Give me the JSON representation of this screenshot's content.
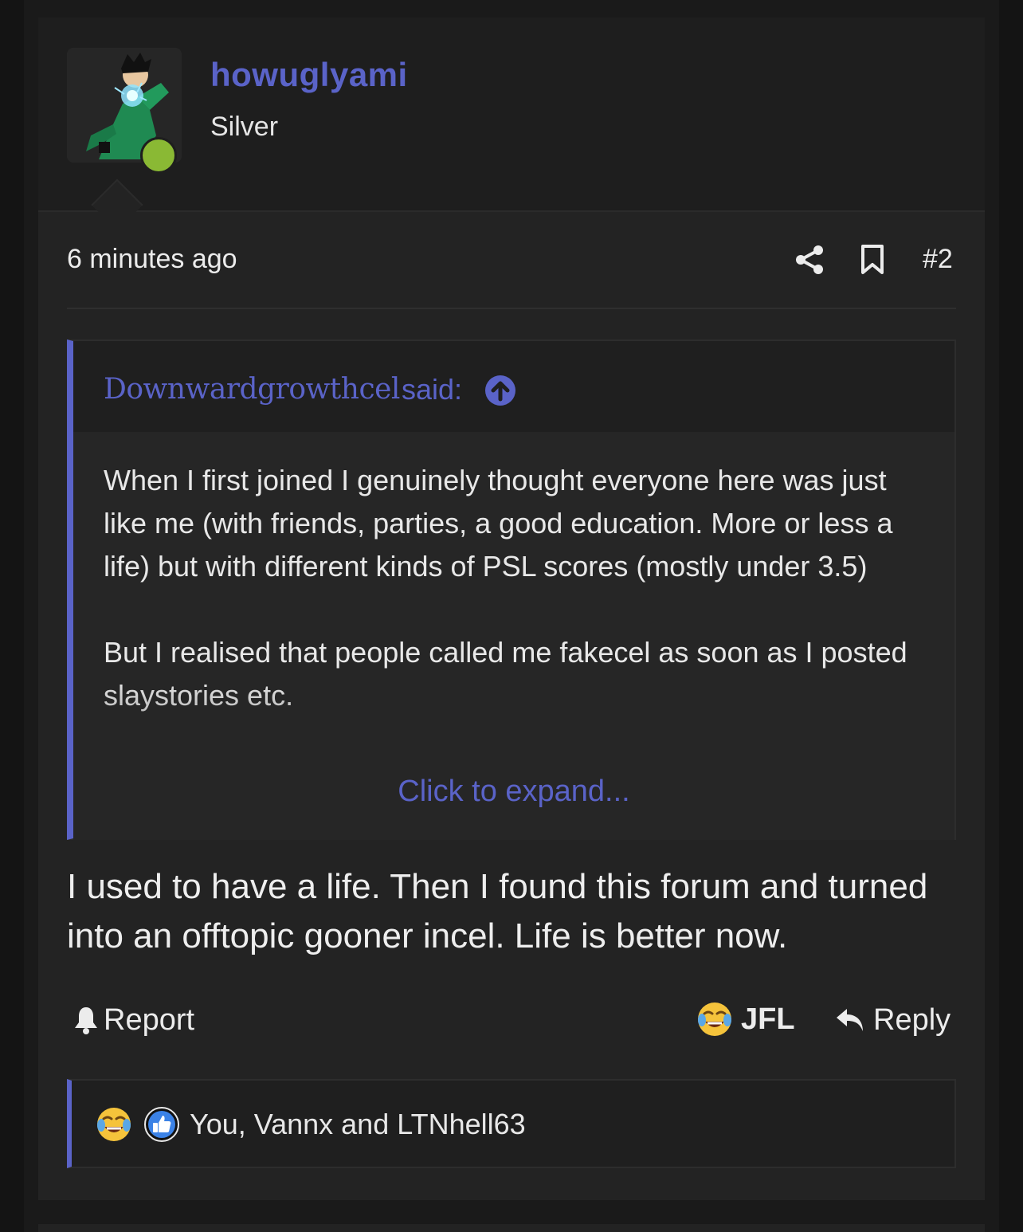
{
  "post": {
    "user": {
      "name": "howuglyami",
      "title": "Silver",
      "online": true
    },
    "meta": {
      "time": "6 minutes ago",
      "number": "#2",
      "share_icon": "share-icon",
      "bookmark_icon": "bookmark-icon"
    },
    "quote": {
      "author": "Downwardgrowthcel",
      "said": "said:",
      "jump_icon": "arrow-up-circle-icon",
      "paragraphs": [
        "When I first joined I genuinely thought everyone here was just like me (with friends, parties, a good education. More or less a life) but with different kinds of PSL scores (mostly under 3.5)",
        "But I realised that people called me fakecel as soon as I posted slaystories etc."
      ],
      "expand": "Click to expand..."
    },
    "message": "I used to have a life. Then I found this forum and turned into an offtopic gooner incel. Life is better now.",
    "actions": {
      "report": "Report",
      "reaction": "JFL",
      "reply": "Reply"
    },
    "reactions": {
      "icons": [
        "joy-cry-emoji-icon",
        "thumbs-up-icon"
      ],
      "text": "You, Vannx and LTNhell63"
    }
  },
  "colors": {
    "accent": "#5a63c8",
    "online": "#8ab934",
    "background": "#232323",
    "text": "#e8e8e8"
  }
}
